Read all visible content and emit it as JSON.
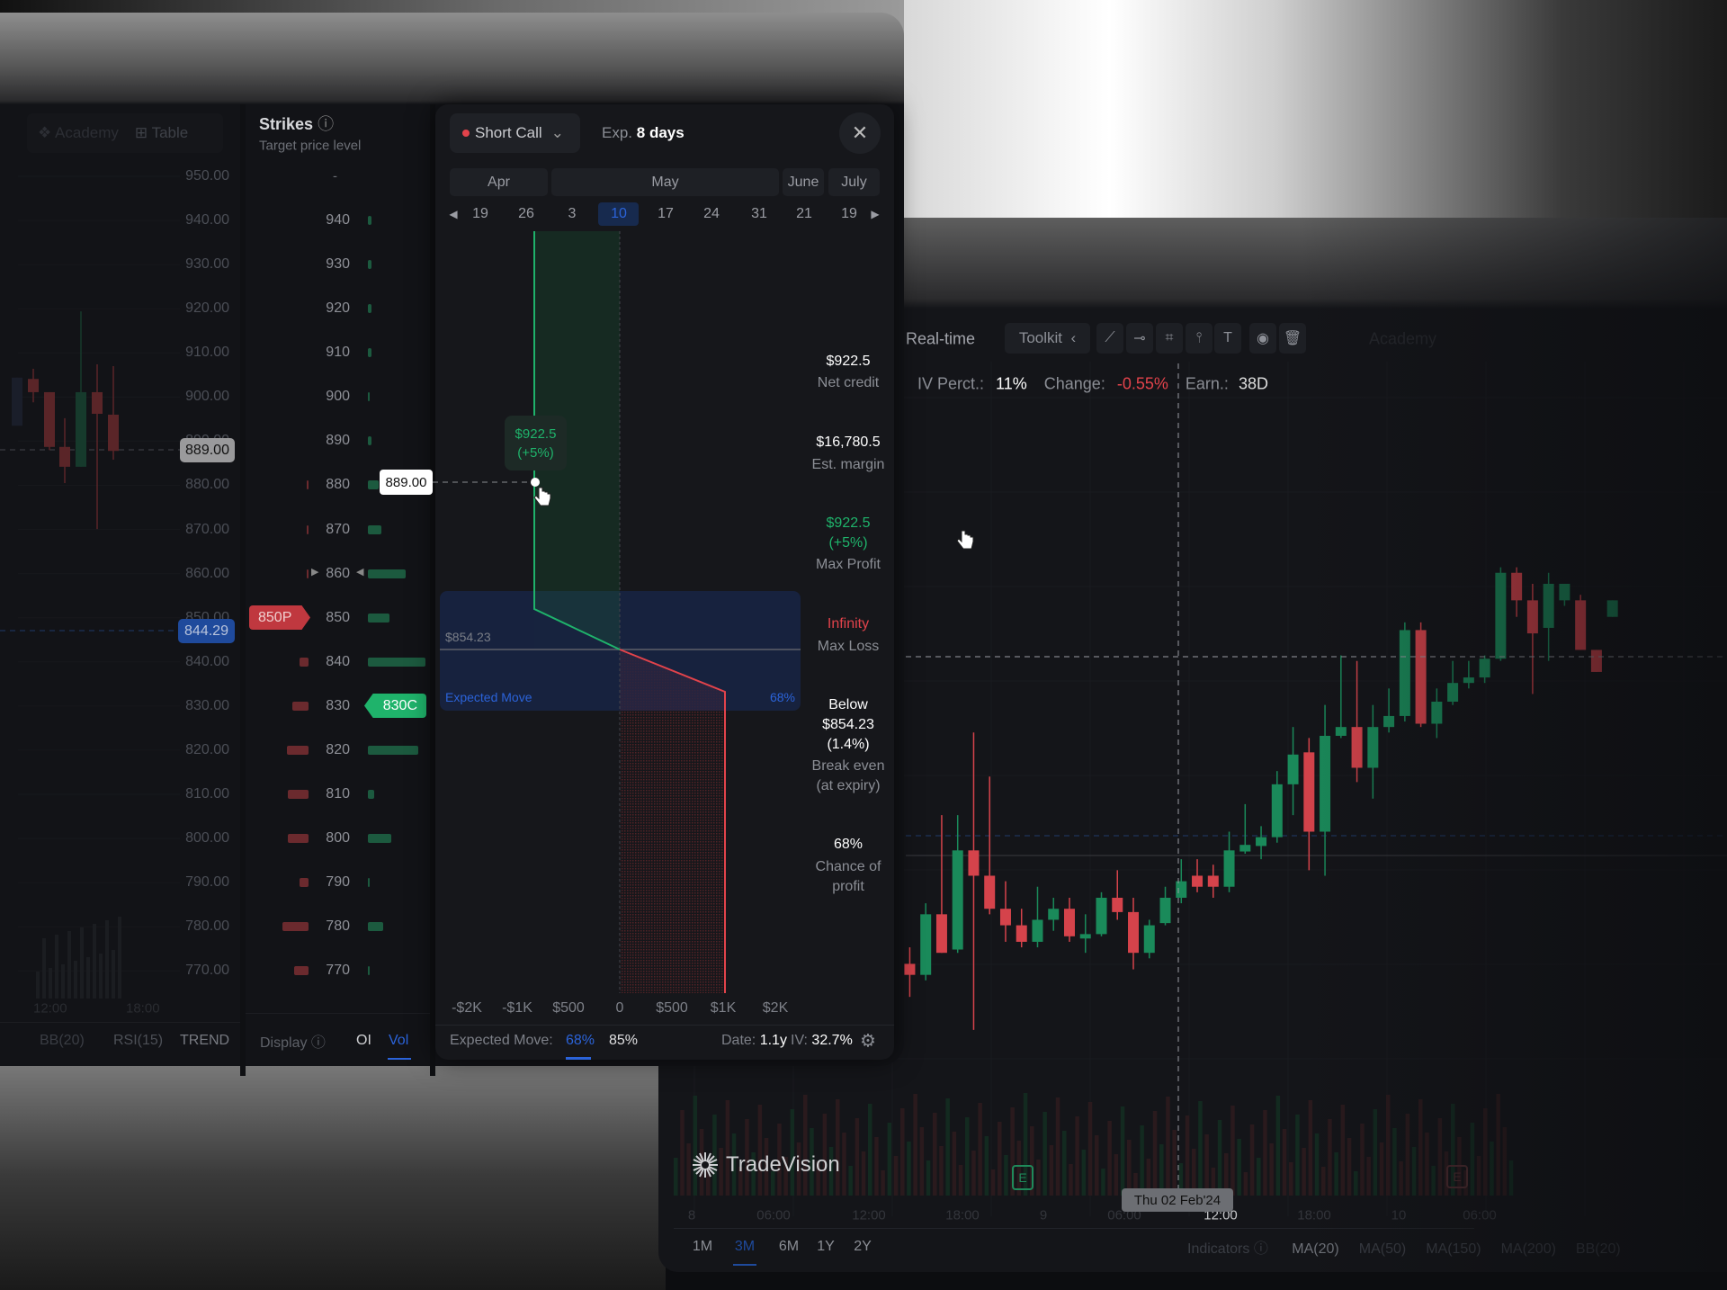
{
  "colors": {
    "green": "#1fb36b",
    "red": "#e2434b",
    "blue": "#2b63d9",
    "panel": "#16171b"
  },
  "back_window": {
    "tabs": [
      {
        "label": "Academy",
        "icon": "academy-icon"
      },
      {
        "label": "Table",
        "icon": "table-icon"
      }
    ],
    "price_axis": [
      "950.00",
      "940.00",
      "930.00",
      "920.00",
      "910.00",
      "900.00",
      "890.00",
      "880.00",
      "870.00",
      "860.00",
      "850.00",
      "840.00",
      "830.00",
      "820.00",
      "810.00",
      "800.00",
      "790.00",
      "780.00",
      "770.00"
    ],
    "current_price_badge": "889.00",
    "last_price_badge": "844.29",
    "time_axis": [
      "12:00",
      "18:00"
    ],
    "indicators": [
      "BB(20)",
      "RSI(15)",
      "TREND"
    ],
    "candles": [
      [
        893.5,
        904.4,
        893.5,
        904.4
      ],
      [
        904.1,
        906.4,
        898.8,
        901.1
      ],
      [
        901.1,
        901.1,
        888,
        888.7
      ],
      [
        888.7,
        895.2,
        880.5,
        884.2
      ],
      [
        884.2,
        919.4,
        884.2,
        901.1
      ],
      [
        901.1,
        907.4,
        870.1,
        896.2
      ],
      [
        896,
        907,
        885.8,
        887.8
      ]
    ]
  },
  "strikes": {
    "title": "Strikes",
    "subtitle": "Target price level",
    "top_placeholder": "-",
    "rows": [
      {
        "strike": "940",
        "call_vol": 3,
        "put_vol": 0
      },
      {
        "strike": "930",
        "call_vol": 3,
        "put_vol": 0
      },
      {
        "strike": "920",
        "call_vol": 3,
        "put_vol": 0
      },
      {
        "strike": "910",
        "call_vol": 3,
        "put_vol": 0
      },
      {
        "strike": "900",
        "call_vol": 2,
        "put_vol": 0
      },
      {
        "strike": "890",
        "call_vol": 3,
        "put_vol": 0
      },
      {
        "strike": "880",
        "call_vol": 10,
        "put_vol": 2
      },
      {
        "strike": "870",
        "call_vol": 12,
        "put_vol": 2
      },
      {
        "strike": "860",
        "call_vol": 34,
        "put_vol": 2
      },
      {
        "strike": "850",
        "call_vol": 20,
        "put_vol": 0
      },
      {
        "strike": "840",
        "call_vol": 52,
        "put_vol": 8
      },
      {
        "strike": "830",
        "call_vol": 0,
        "put_vol": 15
      },
      {
        "strike": "820",
        "call_vol": 46,
        "put_vol": 20
      },
      {
        "strike": "810",
        "call_vol": 6,
        "put_vol": 19
      },
      {
        "strike": "800",
        "call_vol": 21,
        "put_vol": 19
      },
      {
        "strike": "790",
        "call_vol": 2,
        "put_vol": 8
      },
      {
        "strike": "780",
        "call_vol": 14,
        "put_vol": 24
      },
      {
        "strike": "770",
        "call_vol": 2,
        "put_vol": 13
      }
    ],
    "put_badge": "850P",
    "call_badge": "830C",
    "display_label": "Display",
    "display_options": [
      "OI",
      "Vol"
    ],
    "display_selected": "Vol"
  },
  "modal": {
    "strategy": "Short Call",
    "exp_label": "Exp.",
    "exp_value": "8 days",
    "months": [
      "Apr",
      "May",
      "June",
      "July"
    ],
    "dates": [
      "19",
      "26",
      "3",
      "10",
      "17",
      "24",
      "31",
      "21",
      "19"
    ],
    "selected_date": "10",
    "target_price": "889.00",
    "tooltip_value": "$922.5",
    "tooltip_pct": "(+5%)",
    "breakeven_price": "$854.23",
    "expected_move_label": "Expected Move",
    "expected_move_pct": "68%",
    "pnl_axis": [
      "-$2K",
      "-$1K",
      "$500",
      "0",
      "$500",
      "$1K",
      "$2K"
    ],
    "stats": {
      "net_credit": "$922.5",
      "net_credit_label": "Net credit",
      "est_margin": "$16,780.5",
      "est_margin_label": "Est. margin",
      "max_profit": "$922.5",
      "max_profit_pct": "(+5%)",
      "max_profit_label": "Max Profit",
      "max_loss": "Infinity",
      "max_loss_label": "Max Loss",
      "breakeven_1": "Below",
      "breakeven_2": "$854.23",
      "breakeven_3": "(1.4%)",
      "breakeven_label_1": "Break even",
      "breakeven_label_2": "(at expiry)",
      "chance": "68%",
      "chance_label_1": "Chance of",
      "chance_label_2": "profit"
    },
    "footer": {
      "expected_move_label": "Expected Move:",
      "options": [
        "68%",
        "85%"
      ],
      "selected": "68%",
      "date_label": "Date:",
      "date_value": "1.1y",
      "iv_label": "IV:",
      "iv_value": "32.7%"
    }
  },
  "right_window": {
    "realtime": "Real-time",
    "toolkit": "Toolkit",
    "tools": [
      "trendline-icon",
      "horizontal-line-icon",
      "rectangle-icon",
      "vertical-line-icon",
      "text-icon",
      "eye-icon",
      "trash-icon"
    ],
    "faint_tab": "Academy",
    "info": {
      "iv_label": "IV Perct.:",
      "iv_value": "11%",
      "change_label": "Change:",
      "change_value": "-0.55%",
      "earn_label": "Earn.:",
      "earn_value": "38D"
    },
    "brand": "TradeVision",
    "time_axis": [
      "8",
      "06:00",
      "12:00",
      "18:00",
      "9",
      "06:00",
      "12:00",
      "18:00",
      "10",
      "06:00"
    ],
    "crosshair_date": "Thu 02 Feb'24",
    "earnings_marker": "E",
    "ranges": [
      "1M",
      "3M",
      "6M",
      "1Y",
      "2Y"
    ],
    "selected_range": "3M",
    "indicators_label": "Indicators",
    "indicators": [
      "MA(20)",
      "MA(50)",
      "MA(150)",
      "MA(200)",
      "BB(20)"
    ],
    "candles": [
      [
        125,
        140,
        95,
        115
      ],
      [
        115,
        180,
        110,
        170
      ],
      [
        170,
        260,
        135,
        135
      ],
      [
        138,
        260,
        135,
        228
      ],
      [
        228,
        335,
        65,
        205
      ],
      [
        205,
        295,
        170,
        175
      ],
      [
        175,
        200,
        145,
        160
      ],
      [
        160,
        175,
        140,
        145
      ],
      [
        145,
        195,
        140,
        165
      ],
      [
        165,
        185,
        155,
        175
      ],
      [
        175,
        185,
        145,
        150
      ],
      [
        148,
        170,
        135,
        152
      ],
      [
        152,
        190,
        150,
        185
      ],
      [
        185,
        210,
        165,
        172
      ],
      [
        172,
        185,
        120,
        135
      ],
      [
        135,
        165,
        130,
        160
      ],
      [
        162,
        195,
        160,
        185
      ],
      [
        185,
        220,
        180,
        200
      ],
      [
        205,
        220,
        190,
        195
      ],
      [
        205,
        215,
        185,
        195
      ],
      [
        195,
        245,
        190,
        228
      ],
      [
        227,
        270,
        225,
        233
      ],
      [
        232,
        250,
        220,
        240
      ],
      [
        240,
        300,
        235,
        288
      ],
      [
        288,
        340,
        260,
        315
      ],
      [
        317,
        330,
        210,
        245
      ],
      [
        245,
        360,
        205,
        332
      ],
      [
        332,
        405,
        330,
        340
      ],
      [
        340,
        400,
        290,
        303
      ],
      [
        303,
        360,
        275,
        340
      ],
      [
        340,
        375,
        335,
        350
      ],
      [
        350,
        435,
        345,
        428
      ],
      [
        428,
        435,
        340,
        343
      ],
      [
        343,
        375,
        330,
        363
      ],
      [
        363,
        400,
        360,
        380
      ],
      [
        380,
        400,
        375,
        385
      ],
      [
        385,
        405,
        380,
        402
      ],
      [
        402,
        485,
        400,
        480
      ],
      [
        480,
        485,
        440,
        455
      ],
      [
        455,
        470,
        370,
        425
      ],
      [
        430,
        480,
        400,
        470
      ],
      [
        455,
        470,
        450,
        470
      ],
      [
        455,
        460,
        410,
        410
      ],
      [
        410,
        410,
        390,
        390
      ],
      [
        440,
        455,
        440,
        455
      ]
    ]
  }
}
